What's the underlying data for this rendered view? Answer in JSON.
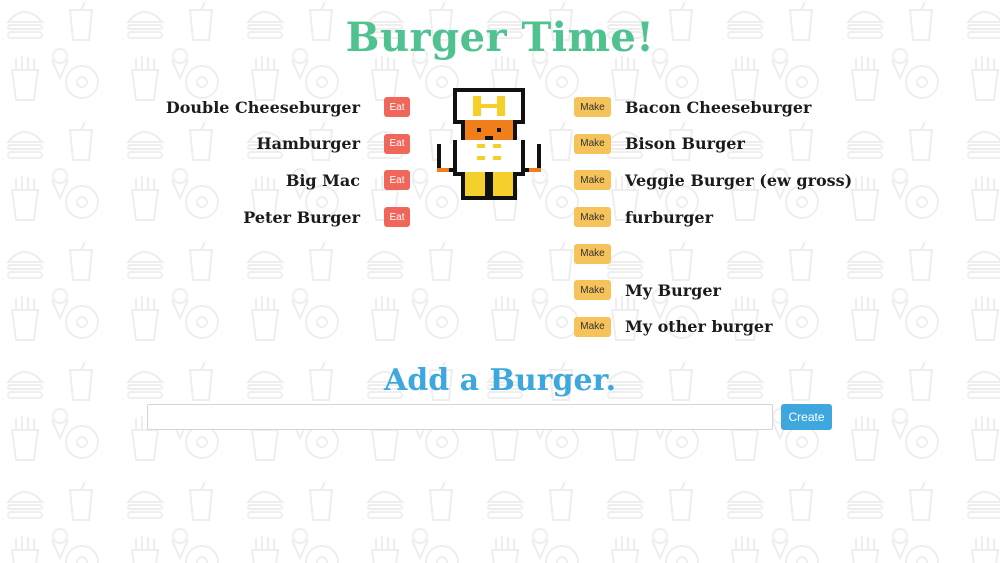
{
  "header": {
    "title": "Burger Time!"
  },
  "eaten_list": {
    "button_label": "Eat",
    "items": [
      {
        "name": "Double Cheeseburger"
      },
      {
        "name": "Hamburger"
      },
      {
        "name": "Big Mac"
      },
      {
        "name": "Peter Burger"
      }
    ]
  },
  "made_list": {
    "button_label": "Make",
    "items": [
      {
        "name": "Bacon Cheeseburger"
      },
      {
        "name": "Bison Burger"
      },
      {
        "name": "Veggie Burger (ew gross)"
      },
      {
        "name": "furburger"
      },
      {
        "name": ""
      },
      {
        "name": "My Burger"
      },
      {
        "name": "My other burger"
      }
    ]
  },
  "add_form": {
    "title": "Add a Burger.",
    "input_value": "",
    "create_label": "Create"
  },
  "colors": {
    "title": "#4fc290",
    "add_title": "#3ea8de",
    "eat_button": "#f0665a",
    "make_button": "#f6c35a",
    "create_button": "#3ea8de"
  }
}
